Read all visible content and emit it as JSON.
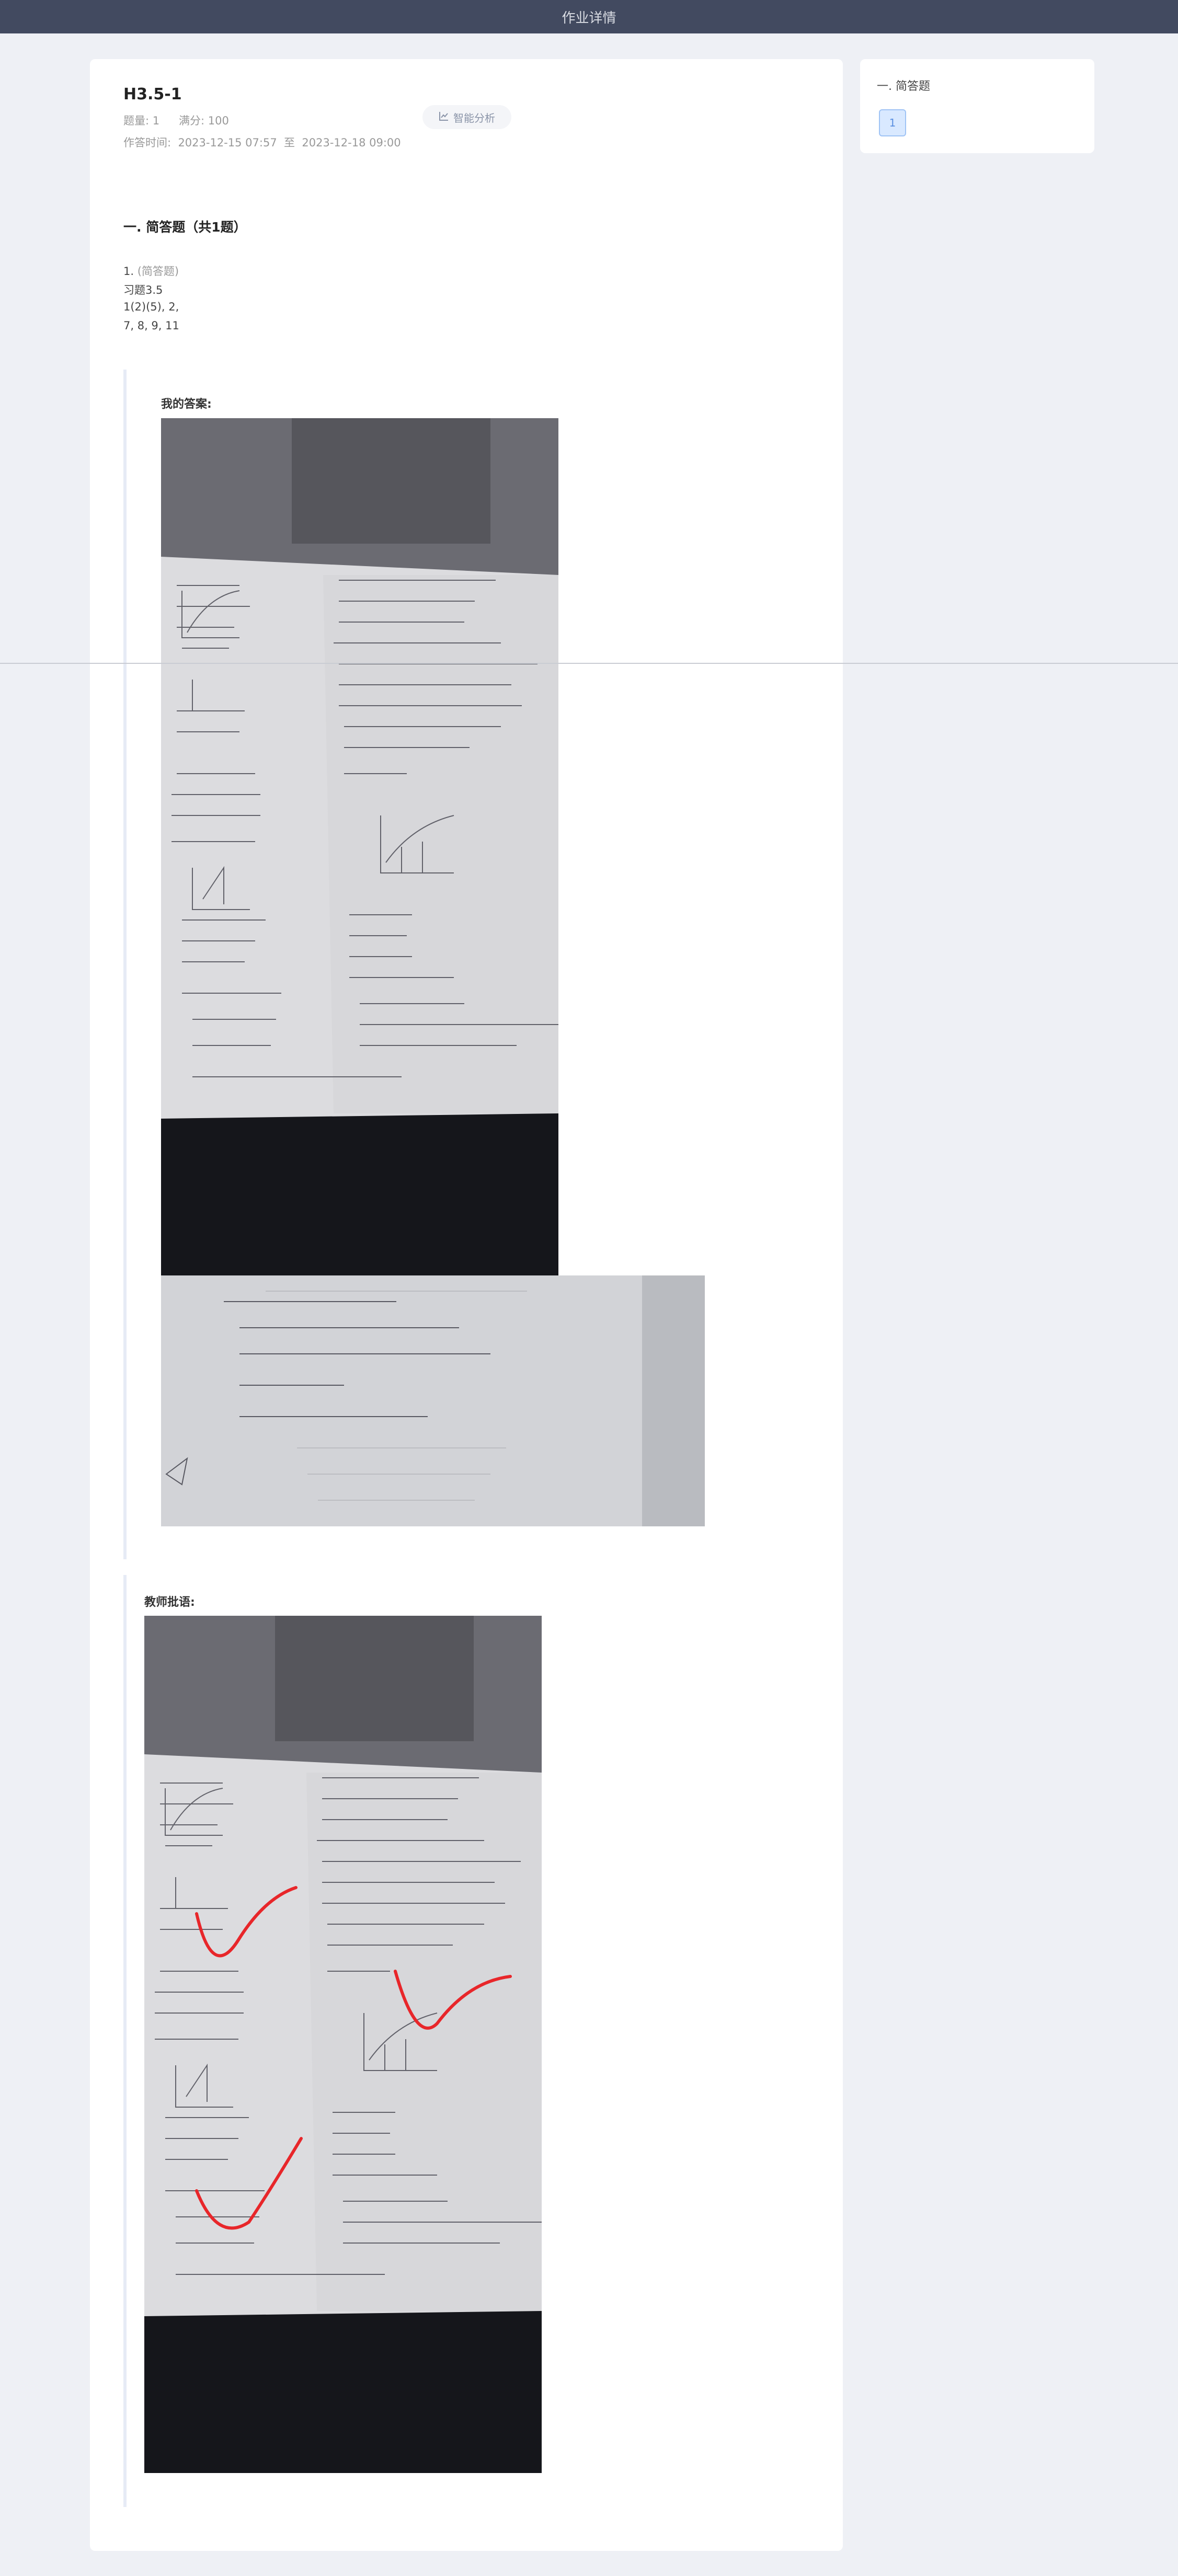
{
  "topbar": {
    "title": "作业详情"
  },
  "homework": {
    "title": "H3.5-1",
    "count_label": "题量:",
    "count_value": "1",
    "score_label": "满分:",
    "score_value": "100",
    "time_label": "作答时间:",
    "time_start": "2023-12-15 07:57",
    "time_sep": "至",
    "time_end": "2023-12-18 09:00",
    "analysis_button": "智能分析"
  },
  "section": {
    "title": "一. 简答题（共1题）"
  },
  "question": {
    "number": "1.",
    "type": "(简答题)",
    "lines": [
      "习题3.5",
      "1(2)(5), 2,",
      "7, 8, 9, 11"
    ]
  },
  "answer": {
    "label": "我的答案:"
  },
  "comment": {
    "label": "教师批语:"
  },
  "sidebar": {
    "section": "一. 简答题",
    "items": [
      "1"
    ]
  },
  "colors": {
    "topbar": "#424a60",
    "background": "#eef0f5",
    "accent": "#5a8fe0",
    "check_mark": "#e8262a"
  },
  "icons": {
    "analysis": "chart-line-icon"
  }
}
